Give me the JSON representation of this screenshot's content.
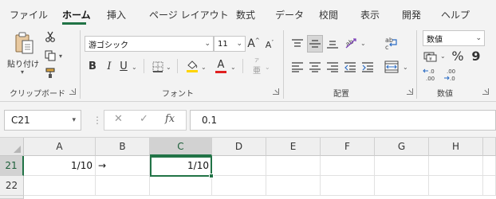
{
  "tabs": [
    "ファイル",
    "ホーム",
    "挿入",
    "ページ レイアウト",
    "数式",
    "データ",
    "校閲",
    "表示",
    "開発",
    "ヘルプ"
  ],
  "active_tab": "ホーム",
  "accent_color": "#217346",
  "ribbon": {
    "clipboard": {
      "paste_label": "貼り付け",
      "group_label": "クリップボード",
      "icons": [
        "paste-icon",
        "cut-icon",
        "copy-icon",
        "format-painter-icon"
      ]
    },
    "font": {
      "font_name": "游ゴシック",
      "font_size": "11",
      "group_label": "フォント",
      "bold": "B",
      "italic": "I",
      "underline": "U",
      "grow": "A",
      "shrink": "A",
      "font_color_letter": "A",
      "phonetic": "亜",
      "highlight_color": "#ffd400",
      "font_color": "#e02020"
    },
    "alignment": {
      "group_label": "配置"
    },
    "number": {
      "format": "数値",
      "percent": "%",
      "comma": "9",
      "inc_decimal": "←.0\n.00",
      "dec_decimal": ".00\n→.0",
      "group_label": "数値"
    }
  },
  "formula_bar": {
    "name_box": "C21",
    "fx": "fx",
    "cancel": "✕",
    "enter": "✓",
    "formula": "0.1"
  },
  "grid": {
    "columns": [
      "A",
      "B",
      "C",
      "D",
      "E",
      "F",
      "G",
      "H"
    ],
    "selected_column": "C",
    "rows": [
      {
        "num": "21",
        "selected": true,
        "cells": {
          "A": "1/10",
          "B": "→",
          "C": "1/10"
        }
      },
      {
        "num": "22",
        "selected": false,
        "cells": {}
      }
    ]
  }
}
